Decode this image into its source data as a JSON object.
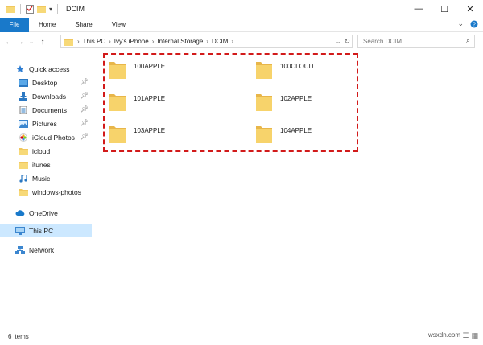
{
  "window": {
    "title": "DCIM",
    "controls": {
      "minimize": "—",
      "maximize": "☐",
      "close": "✕"
    }
  },
  "ribbon": {
    "tabs": [
      "File",
      "Home",
      "Share",
      "View"
    ],
    "expand_icon": "chevron-down-icon",
    "help_icon": "help-icon"
  },
  "address": {
    "crumbs": [
      "This PC",
      "Ivy's iPhone",
      "Internal Storage",
      "DCIM"
    ],
    "search_placeholder": "Search DCIM"
  },
  "sidebar": {
    "quick_access": "Quick access",
    "items": [
      {
        "label": "Desktop",
        "pinned": true
      },
      {
        "label": "Downloads",
        "pinned": true
      },
      {
        "label": "Documents",
        "pinned": true
      },
      {
        "label": "Pictures",
        "pinned": true
      },
      {
        "label": "iCloud Photos",
        "pinned": true
      },
      {
        "label": "icloud",
        "pinned": false
      },
      {
        "label": "itunes",
        "pinned": false
      },
      {
        "label": "Music",
        "pinned": false
      },
      {
        "label": "windows-photos",
        "pinned": false
      }
    ],
    "onedrive": "OneDrive",
    "thispc": "This PC",
    "network": "Network"
  },
  "folders": [
    "100APPLE",
    "100CLOUD",
    "101APPLE",
    "102APPLE",
    "103APPLE",
    "104APPLE"
  ],
  "status": {
    "items": "6 items",
    "watermark": "wsxdn.com"
  },
  "colors": {
    "accent": "#1979ca",
    "selection_dash": "#d21a1a",
    "folder": "#f0c75e",
    "active_nav": "#cce8ff"
  }
}
